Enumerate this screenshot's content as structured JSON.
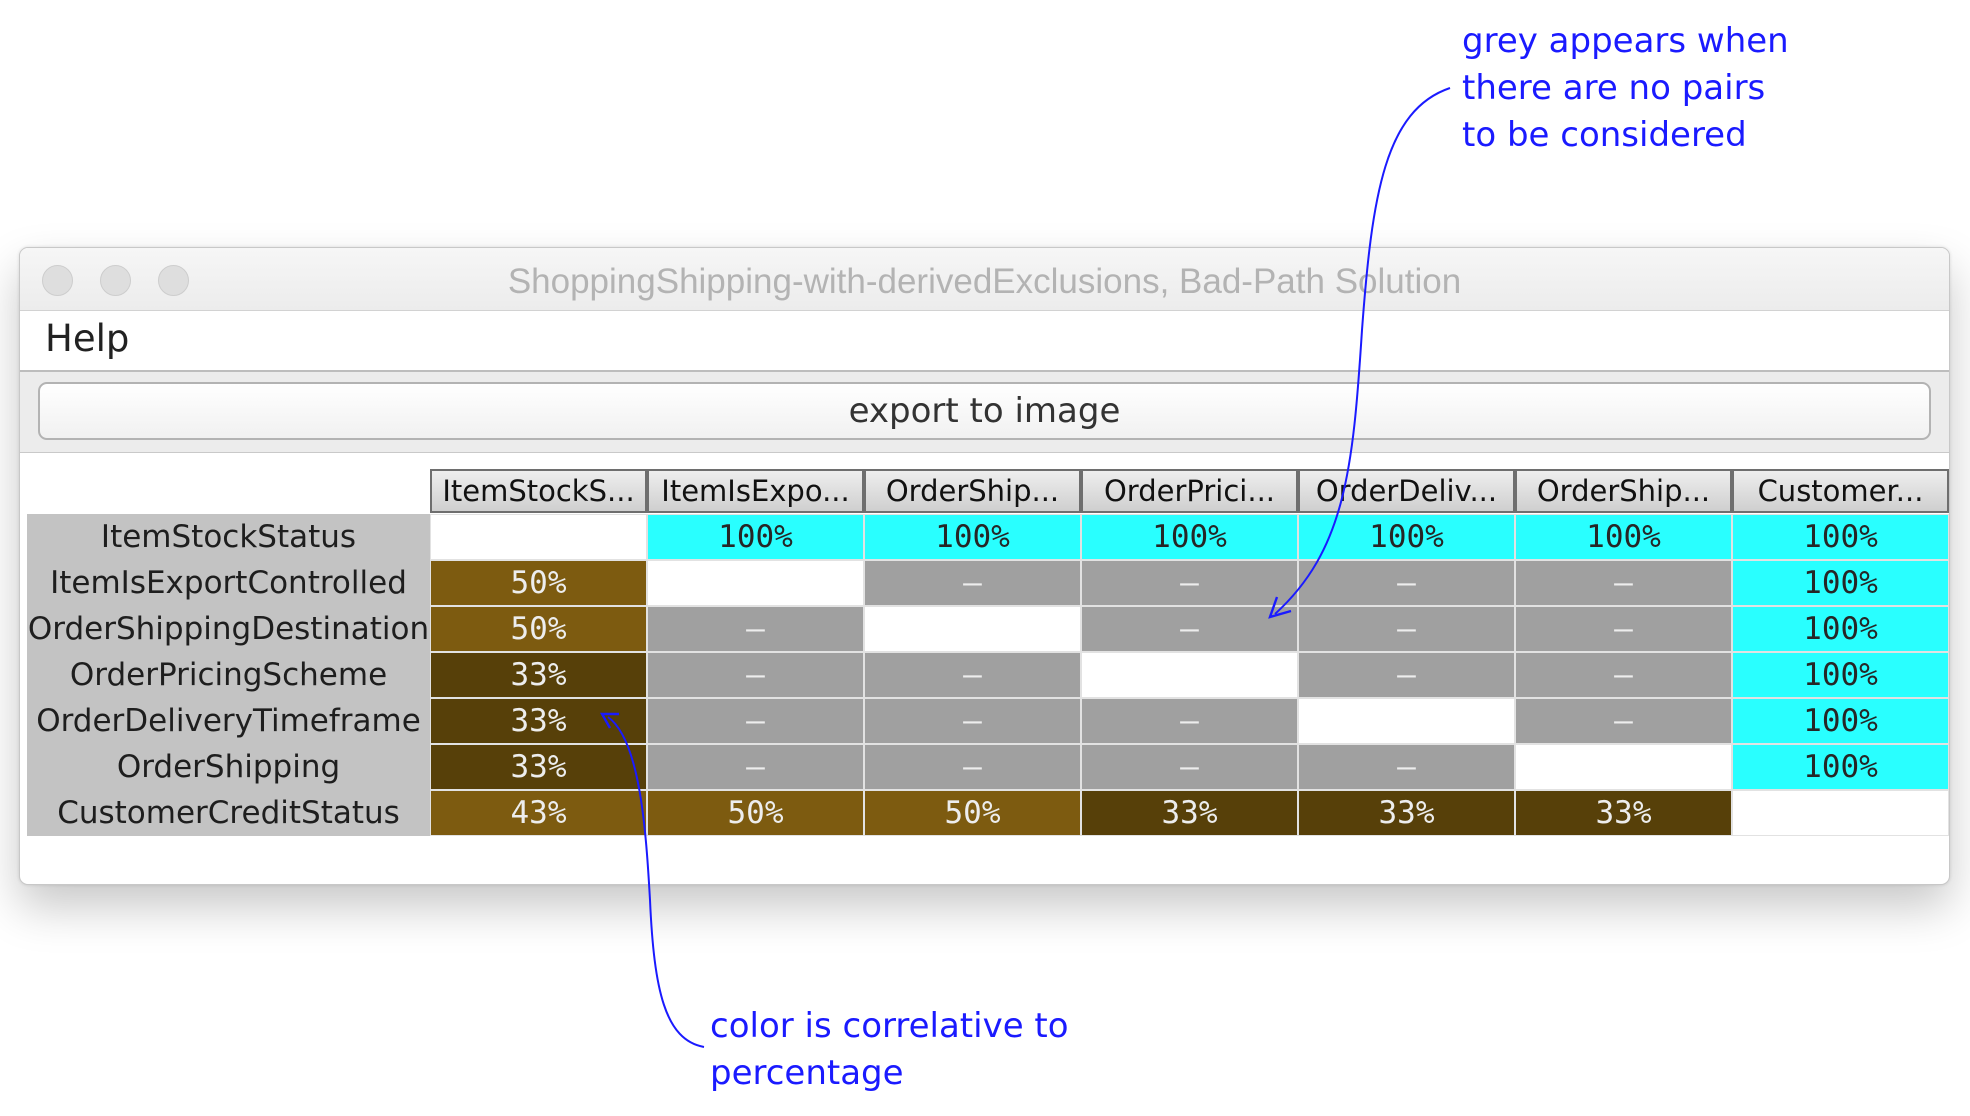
{
  "annotations": {
    "grey_note": "grey appears when\nthere are no pairs\nto be considered",
    "color_note": "color is correlative to\npercentage"
  },
  "window": {
    "title": "ShoppingShipping-with-derivedExclusions, Bad-Path Solution",
    "menu": [
      "Help"
    ],
    "export_button": "export to image"
  },
  "colors": {
    "cyan": "#29ffff",
    "gold": "#7d5b10",
    "brown": "#574009",
    "grey": "#a0a0a0",
    "white": "#ffffff",
    "annotation": "#1a1aff"
  },
  "table": {
    "column_headers": [
      "ItemStockS...",
      "ItemIsExpo...",
      "OrderShip...",
      "OrderPrici...",
      "OrderDeliv...",
      "OrderShip...",
      "Customer..."
    ],
    "row_labels": [
      "ItemStockStatus",
      "ItemIsExportControlled",
      "OrderShippingDestination",
      "OrderPricingScheme",
      "OrderDeliveryTimeframe",
      "OrderShipping",
      "CustomerCreditStatus"
    ],
    "rows": [
      [
        {
          "text": "",
          "color": "white"
        },
        {
          "text": "100%",
          "color": "cyan"
        },
        {
          "text": "100%",
          "color": "cyan"
        },
        {
          "text": "100%",
          "color": "cyan"
        },
        {
          "text": "100%",
          "color": "cyan"
        },
        {
          "text": "100%",
          "color": "cyan"
        },
        {
          "text": "100%",
          "color": "cyan"
        }
      ],
      [
        {
          "text": "50%",
          "color": "gold"
        },
        {
          "text": "",
          "color": "white"
        },
        {
          "text": "–",
          "color": "grey"
        },
        {
          "text": "–",
          "color": "grey"
        },
        {
          "text": "–",
          "color": "grey"
        },
        {
          "text": "–",
          "color": "grey"
        },
        {
          "text": "100%",
          "color": "cyan"
        }
      ],
      [
        {
          "text": "50%",
          "color": "gold"
        },
        {
          "text": "–",
          "color": "grey"
        },
        {
          "text": "",
          "color": "white"
        },
        {
          "text": "–",
          "color": "grey"
        },
        {
          "text": "–",
          "color": "grey"
        },
        {
          "text": "–",
          "color": "grey"
        },
        {
          "text": "100%",
          "color": "cyan"
        }
      ],
      [
        {
          "text": "33%",
          "color": "brown"
        },
        {
          "text": "–",
          "color": "grey"
        },
        {
          "text": "–",
          "color": "grey"
        },
        {
          "text": "",
          "color": "white"
        },
        {
          "text": "–",
          "color": "grey"
        },
        {
          "text": "–",
          "color": "grey"
        },
        {
          "text": "100%",
          "color": "cyan"
        }
      ],
      [
        {
          "text": "33%",
          "color": "brown"
        },
        {
          "text": "–",
          "color": "grey"
        },
        {
          "text": "–",
          "color": "grey"
        },
        {
          "text": "–",
          "color": "grey"
        },
        {
          "text": "",
          "color": "white"
        },
        {
          "text": "–",
          "color": "grey"
        },
        {
          "text": "100%",
          "color": "cyan"
        }
      ],
      [
        {
          "text": "33%",
          "color": "brown"
        },
        {
          "text": "–",
          "color": "grey"
        },
        {
          "text": "–",
          "color": "grey"
        },
        {
          "text": "–",
          "color": "grey"
        },
        {
          "text": "–",
          "color": "grey"
        },
        {
          "text": "",
          "color": "white"
        },
        {
          "text": "100%",
          "color": "cyan"
        }
      ],
      [
        {
          "text": "43%",
          "color": "gold"
        },
        {
          "text": "50%",
          "color": "gold"
        },
        {
          "text": "50%",
          "color": "gold"
        },
        {
          "text": "33%",
          "color": "brown"
        },
        {
          "text": "33%",
          "color": "brown"
        },
        {
          "text": "33%",
          "color": "brown"
        },
        {
          "text": "",
          "color": "white"
        }
      ]
    ]
  }
}
